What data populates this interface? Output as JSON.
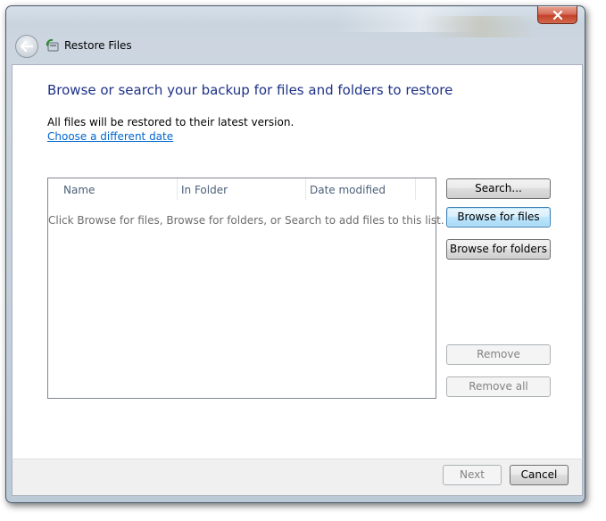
{
  "window": {
    "title": "Restore Files",
    "close_icon": "close-icon",
    "back_icon": "back-arrow-icon",
    "app_icon": "restore-files-icon"
  },
  "main": {
    "heading": "Browse or search your backup for files and folders to restore",
    "info": "All files will be restored to their latest version.",
    "choose_date_link": "Choose a different date"
  },
  "file_list": {
    "columns": [
      "Name",
      "In Folder",
      "Date modified"
    ],
    "empty_message": "Click Browse for files, Browse for folders, or Search to add files to this list."
  },
  "buttons": {
    "search": "Search...",
    "browse_files": "Browse for files",
    "browse_folders": "Browse for folders",
    "remove": "Remove",
    "remove_all": "Remove all",
    "next": "Next",
    "cancel": "Cancel"
  },
  "colors": {
    "heading": "#1e3287",
    "link": "#0066cc",
    "close_button": "#c2412a",
    "default_button_border": "#3c7fb1"
  }
}
